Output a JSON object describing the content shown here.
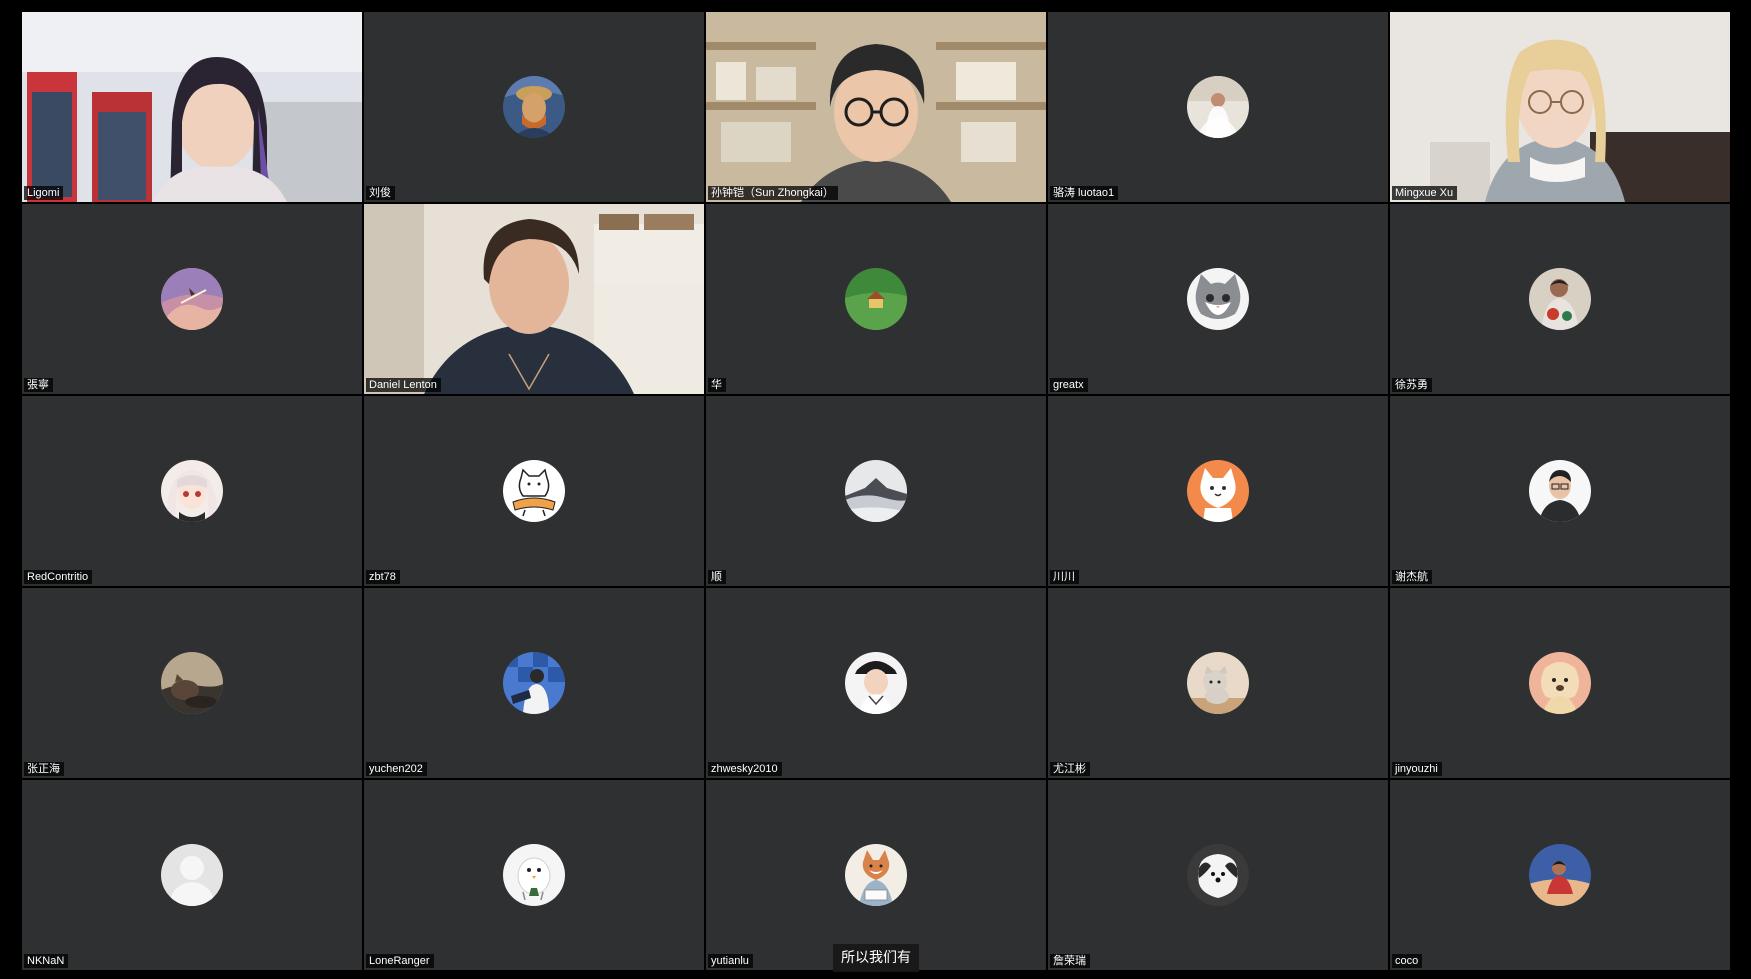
{
  "participants": [
    {
      "name": "Ligomi",
      "kind": "video",
      "scene": "store"
    },
    {
      "name": "刘俊",
      "kind": "avatar",
      "avatar": "portrait-painting"
    },
    {
      "name": "孙钟铠（Sun Zhongkai）",
      "kind": "video",
      "scene": "bookshelf"
    },
    {
      "name": "骆涛 luotao1",
      "kind": "avatar",
      "avatar": "wedding-photo"
    },
    {
      "name": "Mingxue Xu",
      "kind": "video",
      "scene": "sofa"
    },
    {
      "name": "張寧",
      "kind": "avatar",
      "avatar": "sky-bird"
    },
    {
      "name": "Daniel Lenton",
      "kind": "video",
      "scene": "kitchen",
      "speaking": true
    },
    {
      "name": "华",
      "kind": "avatar",
      "avatar": "green-field"
    },
    {
      "name": "greatx",
      "kind": "avatar",
      "avatar": "gray-cat"
    },
    {
      "name": "徐苏勇",
      "kind": "avatar",
      "avatar": "person-photo"
    },
    {
      "name": "RedContritio",
      "kind": "avatar",
      "avatar": "anime-girl"
    },
    {
      "name": "zbt78",
      "kind": "avatar",
      "avatar": "cartoon-dog"
    },
    {
      "name": "顺",
      "kind": "avatar",
      "avatar": "mountain-clouds"
    },
    {
      "name": "川川",
      "kind": "avatar",
      "avatar": "orange-cartoon"
    },
    {
      "name": "谢杰航",
      "kind": "avatar",
      "avatar": "man-glasses"
    },
    {
      "name": "张正海",
      "kind": "avatar",
      "avatar": "cat-photo"
    },
    {
      "name": "yuchen202",
      "kind": "avatar",
      "avatar": "chess-photo"
    },
    {
      "name": "zhwesky2010",
      "kind": "avatar",
      "avatar": "boy-hat"
    },
    {
      "name": "尤江彬",
      "kind": "avatar",
      "avatar": "puppy"
    },
    {
      "name": "jinyouzhi",
      "kind": "avatar",
      "avatar": "alpaca"
    },
    {
      "name": "NKNaN",
      "kind": "avatar",
      "avatar": "default-person"
    },
    {
      "name": "LoneRanger",
      "kind": "avatar",
      "avatar": "white-bird"
    },
    {
      "name": "yutianlu",
      "kind": "avatar",
      "avatar": "fox-reading"
    },
    {
      "name": "詹荣瑞",
      "kind": "avatar",
      "avatar": "fluffy-dog"
    },
    {
      "name": "coco",
      "kind": "avatar",
      "avatar": "person-blue"
    }
  ],
  "caption": "所以我们有",
  "colors": {
    "tile_bg": "#2e3031",
    "speaker_border": "#3ec46d",
    "page_bg": "#000000"
  }
}
